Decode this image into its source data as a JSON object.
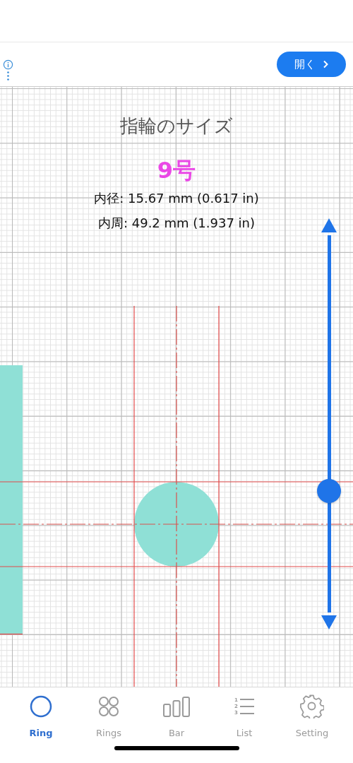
{
  "ad_bar": {
    "open_button": "開く"
  },
  "ring_size": {
    "title": "指輪のサイズ",
    "size": "9号",
    "diameter": "内径: 15.67 mm (0.617 in)",
    "circumference": "内周: 49.2 mm (1.937 in)"
  },
  "slider": {
    "level": 0.31
  },
  "tabs": [
    {
      "label": "Ring",
      "kind": "ring",
      "selected": true
    },
    {
      "label": "Rings",
      "kind": "rings",
      "selected": false
    },
    {
      "label": "Bar",
      "kind": "bar",
      "selected": false
    },
    {
      "label": "List",
      "kind": "list",
      "selected": false,
      "icon_digits": [
        "1",
        "2",
        "3"
      ]
    },
    {
      "label": "Setting",
      "kind": "setting",
      "selected": false
    }
  ]
}
